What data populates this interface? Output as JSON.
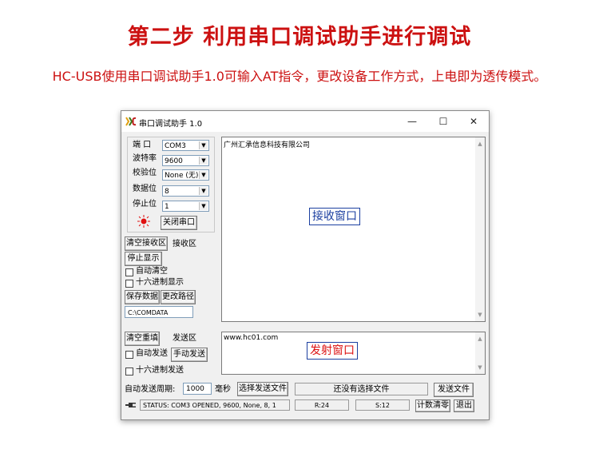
{
  "header": {
    "title": "第二步 利用串口调试助手进行调试",
    "subtitle": "HC-USB使用串口调试助手1.0可输入AT指令，更改设备工作方式，上电即为透传模式。"
  },
  "window": {
    "title": "串口调试助手 1.0",
    "icon_text": "KC",
    "controls": {
      "minimize": "—",
      "maximize": "☐",
      "close": "✕"
    }
  },
  "settings": {
    "port_label": "端 口",
    "port_value": "COM3",
    "baud_label": "波特率",
    "baud_value": "9600",
    "parity_label": "校验位",
    "parity_value": "None (无)",
    "databits_label": "数据位",
    "databits_value": "8",
    "stopbits_label": "停止位",
    "stopbits_value": "1",
    "close_port_button": "关闭串口"
  },
  "receive_controls": {
    "clear_button": "清空接收区",
    "area_label": "接收区",
    "stop_display_button": "停止显示",
    "auto_clear_label": "自动清空",
    "hex_display_label": "十六进制显示",
    "save_data_button": "保存数据",
    "change_path_button": "更改路径",
    "path_value": "C:\\COMDATA"
  },
  "receive_pane": {
    "text": "广州汇承信息科技有限公司",
    "overlay_label": "接收窗口"
  },
  "send_controls": {
    "clear_button": "清空重填",
    "area_label": "发送区",
    "auto_send_label": "自动发送",
    "manual_send_button": "手动发送",
    "hex_send_label": "十六进制发送"
  },
  "send_pane": {
    "text": "www.hc01.com",
    "overlay_label": "发射窗口"
  },
  "bottom": {
    "period_label": "自动发送周期:",
    "period_value": "1000",
    "period_unit": "毫秒",
    "select_file_button": "选择发送文件",
    "file_status": "还没有选择文件",
    "send_file_button": "发送文件"
  },
  "status": {
    "text": "STATUS: COM3 OPENED, 9600, None, 8, 1",
    "rx_count": "R:24",
    "tx_count": "S:12",
    "reset_count_button": "计数清零",
    "exit_button": "退出"
  },
  "colors": {
    "header_red": "#cc1111",
    "overlay_blue": "#1b3fa0",
    "overlay_red": "#dd1111",
    "led_red": "#e01010"
  }
}
